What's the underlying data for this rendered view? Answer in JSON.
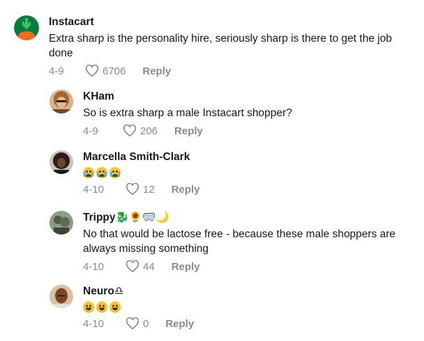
{
  "comments": [
    {
      "name": "Instacart",
      "text": "Extra sharp is the personality hire, seriously sharp is there to get the job done",
      "date": "4-9",
      "likes": "6706",
      "reply": "Reply",
      "avatar_color": "#0a7a3e"
    },
    {
      "name": "KHam",
      "text": "So is extra sharp a male Instacart shopper?",
      "date": "4-9",
      "likes": "206",
      "reply": "Reply",
      "avatar_color": "#b8865a"
    },
    {
      "name": "Marcella Smith-Clark",
      "text": "😭😭😭",
      "date": "4-10",
      "likes": "12",
      "reply": "Reply",
      "avatar_color": "#3b2a22"
    },
    {
      "name": "Trippy🐉🌻🥽🌙",
      "text": "No that would be lactose free - because these male shoppers are always missing something",
      "date": "4-10",
      "likes": "44",
      "reply": "Reply",
      "avatar_color": "#6d7a6a"
    },
    {
      "name": "Neuro♎",
      "text": "😂😂😂",
      "date": "4-10",
      "likes": "0",
      "reply": "Reply",
      "avatar_color": "#9a5a3c"
    }
  ],
  "colors": {
    "text": "#161823",
    "secondary": "#8a8b91",
    "instacart_orange": "#f36d21",
    "instacart_green": "#0a7a3e"
  }
}
